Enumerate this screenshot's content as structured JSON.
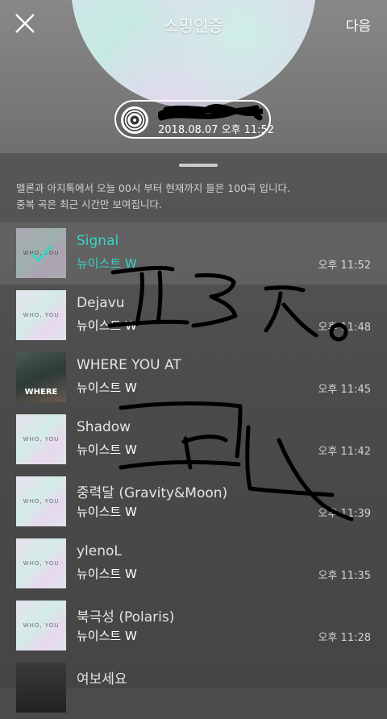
{
  "header": {
    "title": "스밍인증",
    "next_label": "다음",
    "record_date": "2018.08.07 오후 11:52"
  },
  "sheet": {
    "desc_line1": "멜론과 아지톡에서 오늘 00시 부터 현재까지 들은 100곡 입니다.",
    "desc_line2": "중복 곡은 최근 시간만 보여집니다."
  },
  "songs": [
    {
      "title": "Signal",
      "artist": "뉴이스트 W",
      "time": "오후 11:52",
      "selected": true,
      "art": "WHO, YOU"
    },
    {
      "title": "Dejavu",
      "artist": "뉴이스트 W",
      "time": "오후 11:48",
      "selected": false,
      "art": "WHO, YOU"
    },
    {
      "title": "WHERE YOU AT",
      "artist": "뉴이스트 W",
      "time": "오후 11:45",
      "selected": false,
      "art": "WHERE"
    },
    {
      "title": "Shadow",
      "artist": "뉴이스트 W",
      "time": "오후 11:42",
      "selected": false,
      "art": "WHO, YOU"
    },
    {
      "title": "중력달 (Gravity&Moon)",
      "artist": "뉴이스트 W",
      "time": "오후 11:39",
      "selected": false,
      "art": "WHO, YOU"
    },
    {
      "title": "ylenoL",
      "artist": "뉴이스트 W",
      "time": "오후 11:35",
      "selected": false,
      "art": "WHO, YOU"
    },
    {
      "title": "북극성 (Polaris)",
      "artist": "뉴이스트 W",
      "time": "오후 11:28",
      "selected": false,
      "art": "WHO, YOU"
    },
    {
      "title": "여보세요",
      "artist": "",
      "time": "",
      "selected": false,
      "art": ""
    }
  ],
  "colors": {
    "accent": "#35d6c3",
    "doodle": "#000000"
  }
}
